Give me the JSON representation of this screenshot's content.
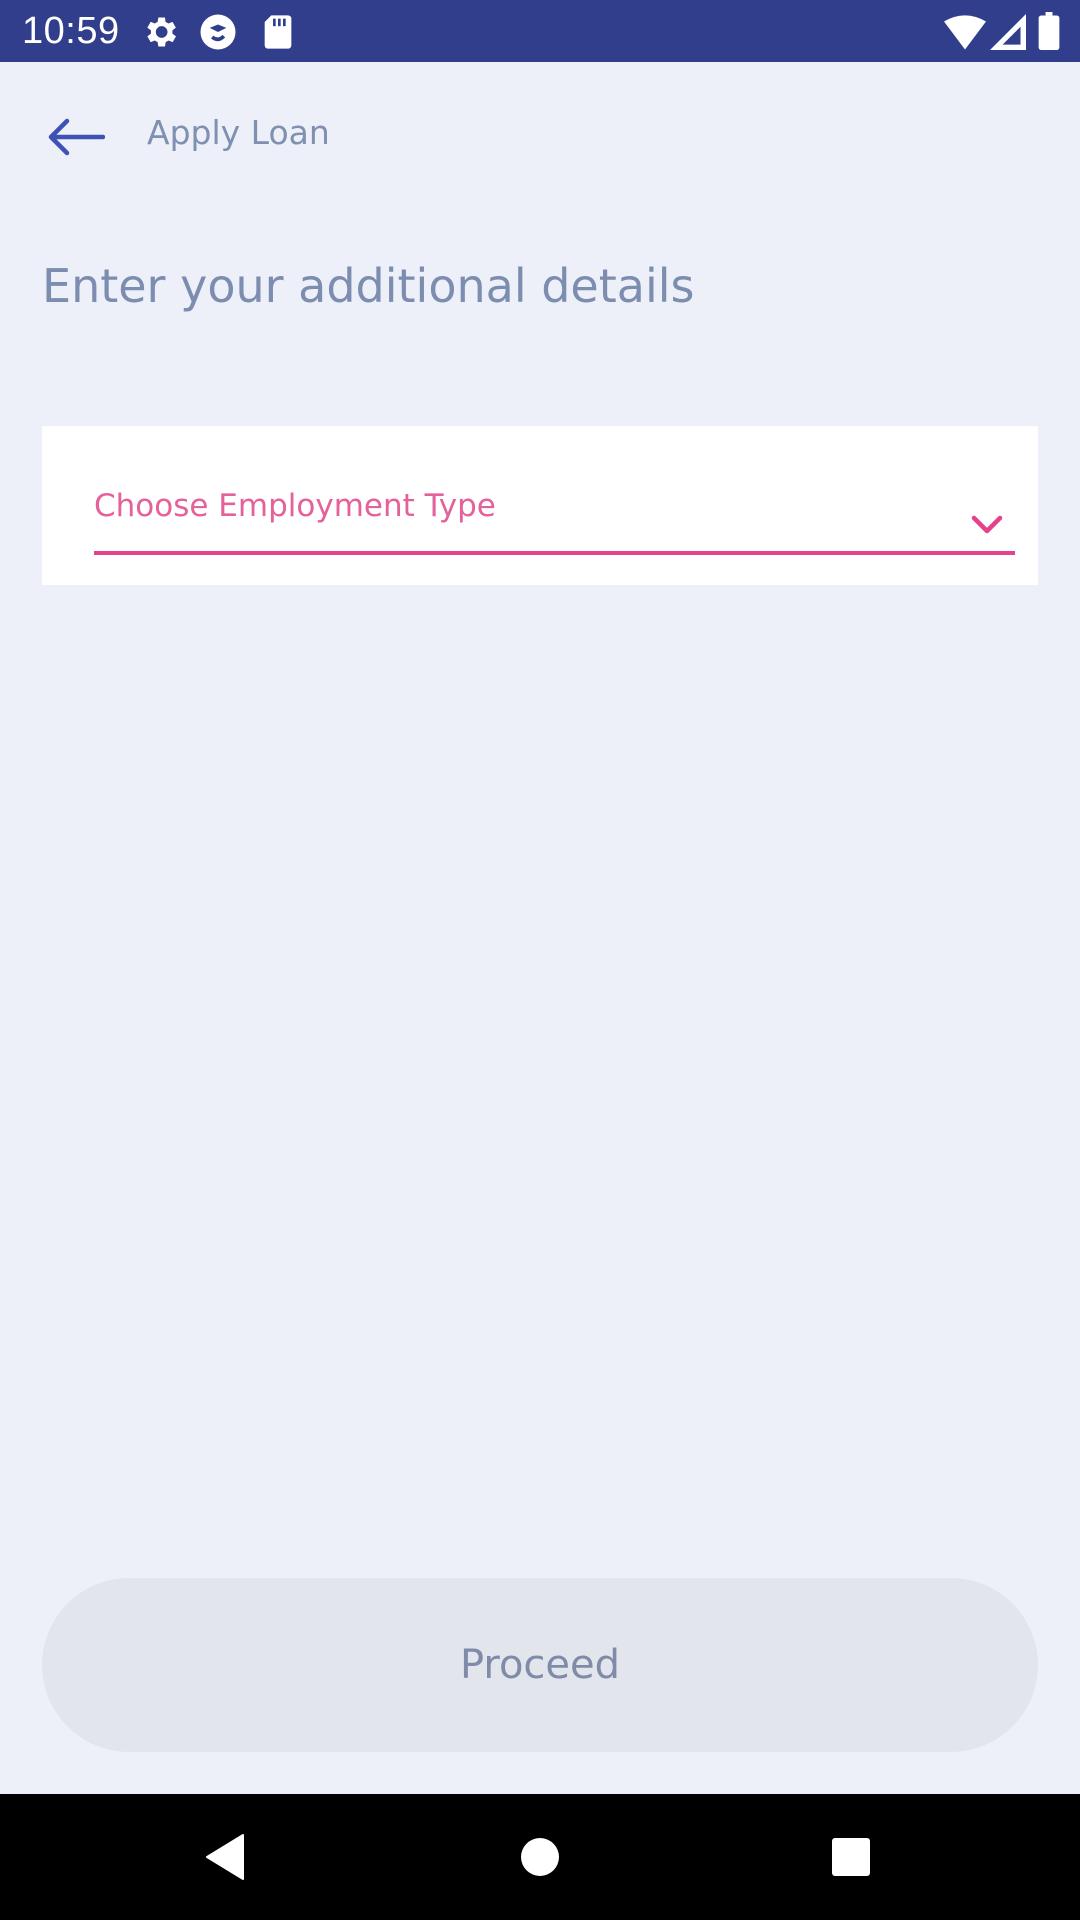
{
  "status_bar": {
    "time": "10:59",
    "icons": [
      "settings-icon",
      "sync-icon",
      "sd-card-icon",
      "wifi-icon",
      "signal-icon",
      "battery-icon"
    ]
  },
  "app_bar": {
    "back_icon": "arrow-left-icon",
    "title": "Apply Loan"
  },
  "main": {
    "heading": "Enter your additional details",
    "employment_dropdown": {
      "label": "Choose Employment Type",
      "selected": "",
      "icon": "chevron-down-icon"
    }
  },
  "footer": {
    "proceed_label": "Proceed"
  },
  "nav_bar": {
    "icons": [
      "back-triangle-icon",
      "home-circle-icon",
      "recents-square-icon"
    ]
  },
  "colors": {
    "status_bar": "#303E8C",
    "background": "#EDF0F8",
    "accent": "#E8418B",
    "back_arrow": "#3F51B5",
    "muted_text": "#7C8DAF",
    "button_disabled": "#E2E5EB"
  }
}
